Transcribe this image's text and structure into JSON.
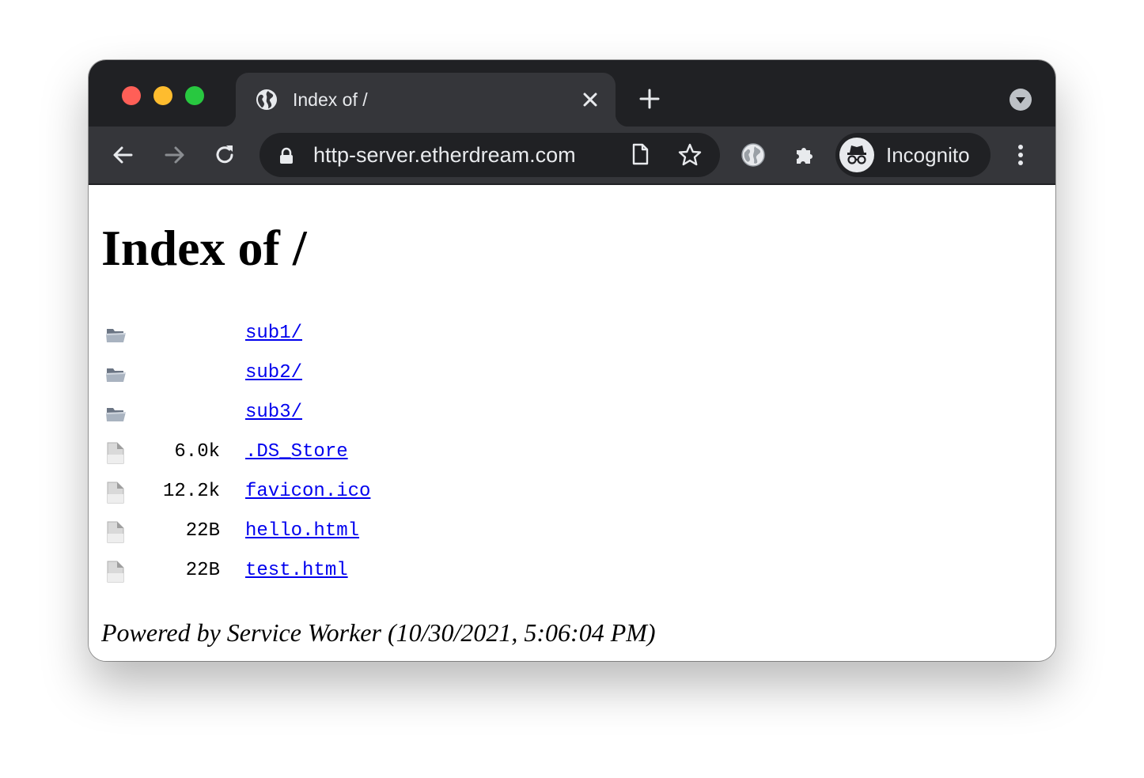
{
  "browser": {
    "tab": {
      "title": "Index of /",
      "favicon": "globe-icon",
      "close_icon": "close-icon"
    },
    "new_tab_icon": "plus-icon",
    "tab_search_icon": "chevron-down-icon",
    "toolbar": {
      "back_icon": "arrow-left-icon",
      "forward_icon": "arrow-right-icon",
      "reload_icon": "reload-icon",
      "url": "http-server.etherdream.com",
      "lock_icon": "lock-icon",
      "page_info_icon": "document-icon",
      "bookmark_icon": "star-icon",
      "extension_globe_icon": "globe-icon",
      "extensions_icon": "puzzle-icon",
      "profile_label": "Incognito",
      "profile_icon": "incognito-icon",
      "menu_icon": "kebab-menu-icon"
    },
    "colors": {
      "titlebar": "#202124",
      "toolbar": "#35363a",
      "text": "#e8eaed",
      "link": "#0000ee",
      "traffic_red": "#ff5f57",
      "traffic_yellow": "#febc2e",
      "traffic_green": "#28c840"
    }
  },
  "page": {
    "heading": "Index of /",
    "entries": [
      {
        "type": "folder",
        "icon": "folder-icon",
        "size": "",
        "name": "sub1/"
      },
      {
        "type": "folder",
        "icon": "folder-icon",
        "size": "",
        "name": "sub2/"
      },
      {
        "type": "folder",
        "icon": "folder-icon",
        "size": "",
        "name": "sub3/"
      },
      {
        "type": "file",
        "icon": "file-icon",
        "size": "6.0k",
        "name": ".DS_Store"
      },
      {
        "type": "file",
        "icon": "file-icon",
        "size": "12.2k",
        "name": "favicon.ico"
      },
      {
        "type": "file",
        "icon": "file-icon",
        "size": "22B",
        "name": "hello.html"
      },
      {
        "type": "file",
        "icon": "file-icon",
        "size": "22B",
        "name": "test.html"
      }
    ],
    "footer": "Powered by Service Worker (10/30/2021, 5:06:04 PM)"
  }
}
